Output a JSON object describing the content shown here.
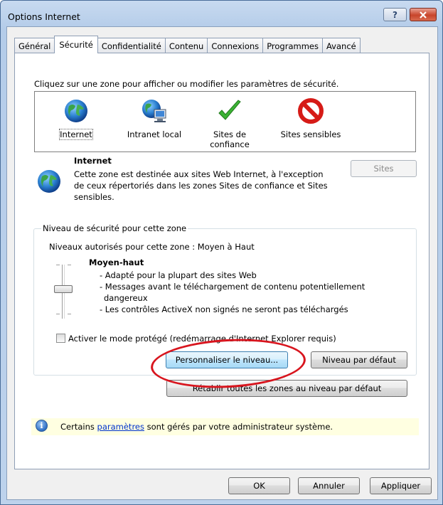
{
  "window": {
    "title": "Options Internet",
    "help_label": "?",
    "close_label": "x"
  },
  "tabs": [
    "Général",
    "Sécurité",
    "Confidentialité",
    "Contenu",
    "Connexions",
    "Programmes",
    "Avancé"
  ],
  "active_tab": "Sécurité",
  "zones": {
    "instruction": "Cliquez sur une zone pour afficher ou modifier les paramètres de sécurité.",
    "items": [
      {
        "label": "Internet",
        "icon": "globe-icon"
      },
      {
        "label": "Intranet local",
        "icon": "network-globe-icon"
      },
      {
        "label": "Sites de confiance",
        "icon": "checkmark-icon"
      },
      {
        "label": "Sites sensibles",
        "icon": "prohibited-icon"
      }
    ],
    "selected": "Internet"
  },
  "zone_info": {
    "title": "Internet",
    "line1": "Cette zone est destinée aux sites Web Internet, à l'exception",
    "line2": "de ceux répertoriés dans les zones Sites de confiance et Sites",
    "line3": "sensibles.",
    "sites_button": "Sites"
  },
  "security_level": {
    "group_title": "Niveau de sécurité pour cette zone",
    "allowed": "Niveaux autorisés pour cette zone : Moyen à Haut",
    "level_name": "Moyen-haut",
    "bullet1": "- Adapté pour la plupart des sites Web",
    "bullet2a": "- Messages avant le téléchargement de contenu potentiellement",
    "bullet2b": "dangereux",
    "bullet3": "- Les contrôles ActiveX non signés ne seront pas téléchargés",
    "protected_mode": "Activer le mode protégé (redémarrage d'Internet Explorer requis)",
    "protected_mode_checked": false,
    "custom_button": "Personnaliser le niveau...",
    "default_button": "Niveau par défaut",
    "reset_all_button": "Rétablir toutes les zones au niveau par défaut"
  },
  "info_bar": {
    "text_before": "Certains",
    "link": "paramètres",
    "text_after": "sont gérés par votre administrateur système."
  },
  "footer": {
    "ok": "OK",
    "cancel": "Annuler",
    "apply": "Appliquer"
  },
  "colors": {
    "annotation": "#d8151e",
    "accent": "#3c7fb1"
  }
}
